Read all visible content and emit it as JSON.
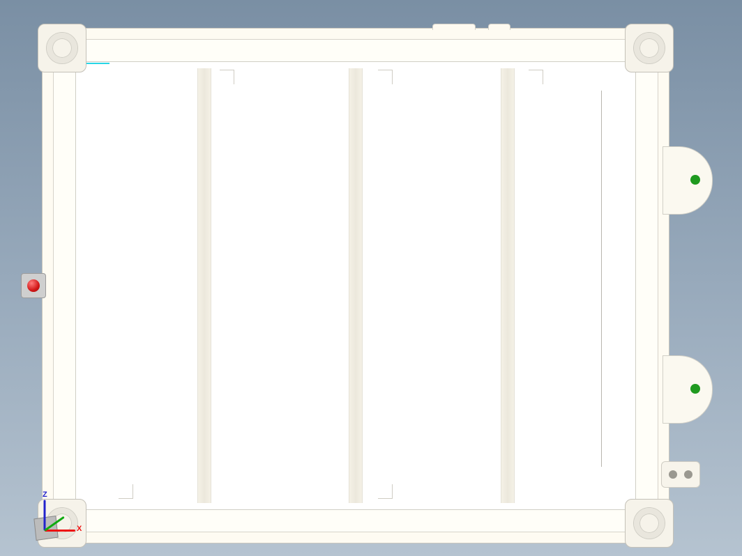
{
  "axes": {
    "x_label": "X",
    "z_label": "Z"
  },
  "indicators": {
    "right_lobe_color": "#1f9a1f",
    "left_knob_color": "#d21717"
  }
}
